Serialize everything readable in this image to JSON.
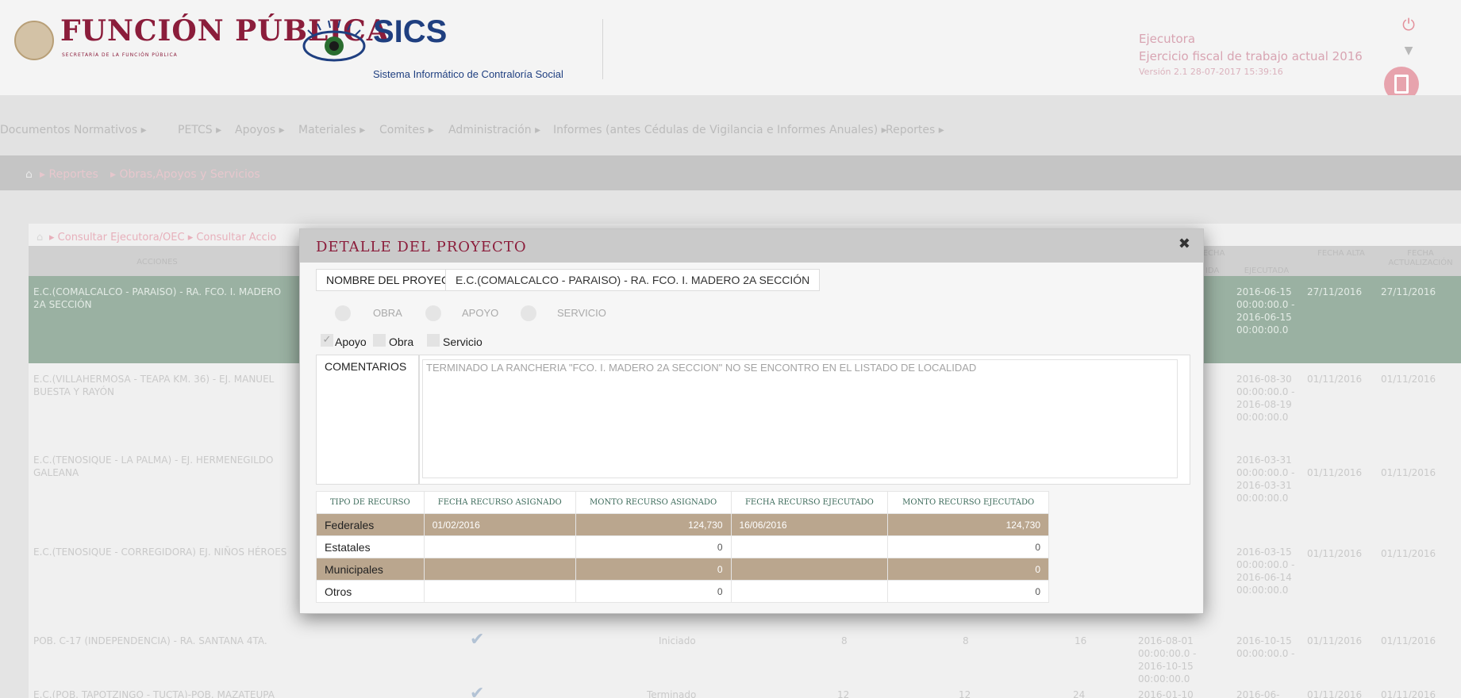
{
  "header": {
    "brand_title": "FUNCIÓN PÚBLICA",
    "brand_subtitle": "SECRETARÍA DE LA FUNCIÓN PÚBLICA",
    "app_title": "SICS",
    "app_subtitle": "Sistema Informático de Contraloría Social",
    "user_role": "Ejecutora",
    "ejercicio": "Ejercicio fiscal de trabajo actual 2016",
    "version": "Versión 2.1   28-07-2017 15:39:16"
  },
  "menu": {
    "items": [
      "Documentos Normativos ▸",
      "PETCS ▸",
      "Apoyos ▸",
      "Materiales ▸",
      "Comites ▸",
      "Administración ▸",
      "Informes (antes Cédulas de Vigilancia e Informes Anuales) ▸",
      "Reportes ▸"
    ]
  },
  "breadcrumb": {
    "items": [
      "▸ Reportes",
      "▸ Obras,Apoyos y Servicios"
    ]
  },
  "background": {
    "sub_breadcrumb": "▸ Consultar Ejecutora/OEC ▸ Consultar Accio",
    "columns": {
      "acciones": "ACCIONES",
      "fecha_head": "FECHA",
      "fecha_ejecutada": "EJECUTADA",
      "ida": "IDA",
      "fecha_alta": "FECHA ALTA",
      "fecha_actualizacion": "FECHA ACTUALIZACIÓN"
    },
    "rows": [
      {
        "name": "E.C.(COMALCALCO - PARAISO) - RA. FCO. I. MADERO 2A SECCIÓN",
        "ejecutada": "2016-06-15 00:00:00.0 - 2016-06-15 00:00:00.0",
        "alta": "27/11/2016",
        "actualizacion": "27/11/2016"
      },
      {
        "name": "E.C.(VILLAHERMOSA - TEAPA KM. 36) - EJ. MANUEL BUESTA Y RAYÓN",
        "ejecutada": "2016-08-30 00:00:00.0 - 2016-08-19 00:00:00.0",
        "alta": "01/11/2016",
        "actualizacion": "01/11/2016"
      },
      {
        "name": "E.C.(TENOSIQUE - LA PALMA) - EJ. HERMENEGILDO GALEANA",
        "ejecutada": "2016-03-31 00:00:00.0 - 2016-03-31 00:00:00.0",
        "alta": "01/11/2016",
        "actualizacion": "01/11/2016"
      },
      {
        "name": "E.C.(TENOSIQUE - CORREGIDORA) EJ. NIÑOS HÉROES",
        "ejecutada": "2016-03-15 00:00:00.0 - 2016-06-14 00:00:00.0",
        "alta": "01/11/2016",
        "actualizacion": "01/11/2016"
      },
      {
        "name": "POB. C-17 (INDEPENDENCIA) - RA. SANTANA 4TA.",
        "status": "Iniciado",
        "c1": "8",
        "c2": "8",
        "c3": "16",
        "programada": "2016-08-01 00:00:00.0 - 2016-10-15 00:00:00.0",
        "ejecutada": "2016-10-15 00:00:00.0 -",
        "alta": "01/11/2016",
        "actualizacion": "01/11/2016"
      },
      {
        "name": "E.C.(POB. TAPOTZINGO - TUCTA)-POB. MAZATEUPA",
        "status": "Terminado",
        "c1": "12",
        "c2": "12",
        "c3": "24",
        "programada": "2016-01-10",
        "ejecutada": "2016-06-",
        "alta": "01/11/2016",
        "actualizacion": "01/11/2016"
      }
    ]
  },
  "modal": {
    "title": "DETALLE DEL PROYECTO",
    "nombre_label": "NOMBRE DEL PROYECTO",
    "nombre_value": "E.C.(COMALCALCO - PARAISO) - RA. FCO. I. MADERO 2A SECCIÓN",
    "radios": [
      "OBRA",
      "APOYO",
      "SERVICIO"
    ],
    "checkboxes": [
      {
        "label": "Apoyo",
        "checked": true
      },
      {
        "label": "Obra",
        "checked": false
      },
      {
        "label": "Servicio",
        "checked": false
      }
    ],
    "comentarios_label": "COMENTARIOS",
    "comentarios_value": "TERMINADO    LA RANCHERIA \"FCO. I. MADERO 2A SECCION\" NO SE ENCONTRO EN EL LISTADO DE LOCALIDAD",
    "table": {
      "headers": [
        "TIPO DE RECURSO",
        "FECHA RECURSO ASIGNADO",
        "MONTO RECURSO ASIGNADO",
        "FECHA RECURSO EJECUTADO",
        "MONTO RECURSO EJECUTADO"
      ],
      "rows": [
        {
          "tipo": "Federales",
          "fecha_asig": "01/02/2016",
          "monto_asig": "124,730",
          "fecha_ejec": "16/06/2016",
          "monto_ejec": "124,730"
        },
        {
          "tipo": "Estatales",
          "fecha_asig": "",
          "monto_asig": "0",
          "fecha_ejec": "",
          "monto_ejec": "0"
        },
        {
          "tipo": "Municipales",
          "fecha_asig": "",
          "monto_asig": "0",
          "fecha_ejec": "",
          "monto_ejec": "0"
        },
        {
          "tipo": "Otros",
          "fecha_asig": "",
          "monto_asig": "0",
          "fecha_ejec": "",
          "monto_ejec": "0"
        }
      ]
    }
  }
}
